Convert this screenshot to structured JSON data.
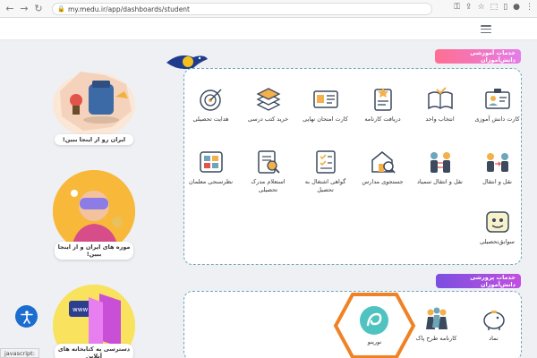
{
  "browser": {
    "url": "my.medu.ir/app/dashboards/student",
    "status_url": "javascript:"
  },
  "banners": [
    {
      "caption": "ایران رو از اینجا ببین!"
    },
    {
      "caption": "موزه های ایران و از اینجا ببین!"
    },
    {
      "caption": "دسترسی به کتابخانه های آنلاین"
    }
  ],
  "education_services": {
    "title": "خدمات آموزشی دانش‌آموزان",
    "tiles": [
      {
        "label": "کارت دانش آموزی",
        "icon": "student-card-icon"
      },
      {
        "label": "انتخاب واحد",
        "icon": "open-book-icon"
      },
      {
        "label": "دریافت کارنامه",
        "icon": "report-card-icon"
      },
      {
        "label": "کارت امتحان نهایی",
        "icon": "exam-card-icon"
      },
      {
        "label": "خرید کتب درسی",
        "icon": "books-stack-icon"
      },
      {
        "label": "هدایت تحصیلی",
        "icon": "target-icon"
      },
      {
        "label": "نقل و انتقال",
        "icon": "transfer-icon"
      },
      {
        "label": "نقل و انتقال سمیاد",
        "icon": "transfer-people-icon"
      },
      {
        "label": "جستجوی مدارس",
        "icon": "school-search-icon"
      },
      {
        "label": "گواهی اشتغال به تحصیل",
        "icon": "certificate-icon"
      },
      {
        "label": "استعلام مدرک تحصیلی",
        "icon": "document-inquiry-icon"
      },
      {
        "label": "نظرسنجی معلمان",
        "icon": "survey-icon"
      },
      {
        "label": "سوابق‌تحصیلی",
        "icon": "records-icon"
      }
    ]
  },
  "training_services": {
    "title": "خدمات پرورشی دانش‌آموزان",
    "tiles": [
      {
        "label": "نماد",
        "icon": "piggy-bank-icon"
      },
      {
        "label": "کارنامه طرح پاک",
        "icon": "kids-group-icon"
      },
      {
        "label": "نورینو",
        "icon": "noorino-logo-icon"
      }
    ]
  },
  "colors": {
    "accent_gradient_start": "#9b4fe0",
    "accent_gradient_end": "#ff6f91",
    "panel_border": "#6ea5b9",
    "highlight_orange": "#f08226",
    "fab_blue": "#1c6dd0"
  }
}
